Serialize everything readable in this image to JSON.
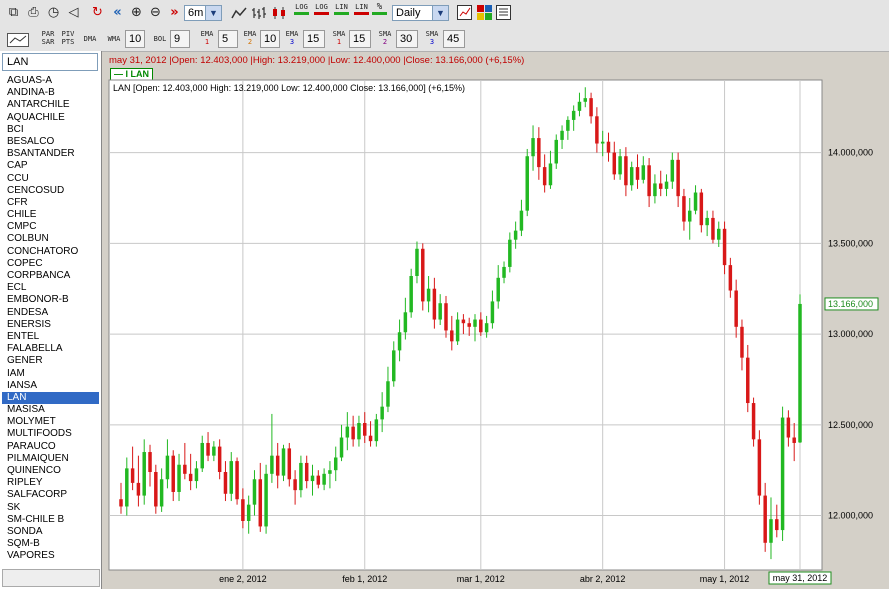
{
  "toolbar1": {
    "period_value": "6m",
    "interval_value": "Daily",
    "scale_buttons": [
      {
        "top": "LOG",
        "name": "log-scale"
      },
      {
        "top": "LOG",
        "name": "log-scale-alt"
      },
      {
        "top": "LIN",
        "name": "linear-scale"
      },
      {
        "top": "LIN",
        "name": "linear-scale-alt"
      },
      {
        "top": "%",
        "name": "percent-scale"
      }
    ]
  },
  "toolbar2": {
    "parsar": {
      "line1": "PAR",
      "line2": "SAR"
    },
    "pivpts": {
      "line1": "PIV",
      "line2": "PTS"
    },
    "dma": "DMA",
    "wma": "WMA",
    "wma_val": "10",
    "bol": "BOL",
    "bol_val": "9",
    "ema1": {
      "line1": "EMA",
      "line2": "1",
      "val": "5"
    },
    "ema2": {
      "line1": "EMA",
      "line2": "2",
      "val": "10"
    },
    "ema3": {
      "line1": "EMA",
      "line2": "3",
      "val": "15"
    },
    "sma1": {
      "line1": "SMA",
      "line2": "1",
      "val": "15"
    },
    "sma2": {
      "line1": "SMA",
      "line2": "2",
      "val": "30"
    },
    "sma3": {
      "line1": "SMA",
      "line2": "3",
      "val": "45"
    }
  },
  "sidebar": {
    "symbol_input": "LAN",
    "symbols": [
      "AGUAS-A",
      "ANDINA-B",
      "ANTARCHILE",
      "AQUACHILE",
      "BCI",
      "BESALCO",
      "BSANTANDER",
      "CAP",
      "CCU",
      "CENCOSUD",
      "CFR",
      "CHILE",
      "CMPC",
      "COLBUN",
      "CONCHATORO",
      "COPEC",
      "CORPBANCA",
      "ECL",
      "EMBONOR-B",
      "ENDESA",
      "ENERSIS",
      "ENTEL",
      "FALABELLA",
      "GENER",
      "IAM",
      "IANSA",
      "LAN",
      "MASISA",
      "MOLYMET",
      "MULTIFOODS",
      "PARAUCO",
      "PILMAIQUEN",
      "QUINENCO",
      "RIPLEY",
      "SALFACORP",
      "SK",
      "SM-CHILE B",
      "SONDA",
      "SQM-B",
      "VAPORES"
    ],
    "selected": "LAN"
  },
  "infobar": "may 31, 2012 |Open: 12.403,000 |High: 13.219,000 |Low: 12.400,000 |Close: 13.166,000 (+6,15%)",
  "legend_tab": "— I LAN",
  "chart_header": "LAN [Open: 12.403,000  High: 13.219,000  Low: 12.400,000  Close: 13.166,000] (+6,15%)",
  "colors": {
    "up": "#22b822",
    "down": "#d81818",
    "grid": "#c8c8c8",
    "last_label": "#1e8c1e",
    "info": "#c00000"
  },
  "chart_data": {
    "type": "candlestick",
    "title": "LAN [Open: 12.403,000  High: 13.219,000  Low: 12.400,000  Close: 13.166,000] (+6,15%)",
    "ylim": [
      11700000,
      14400000
    ],
    "y_ticks": [
      12000000,
      12500000,
      13000000,
      13500000,
      14000000
    ],
    "y_tick_labels": [
      "12.000,000",
      "12.500,000",
      "13.000,000",
      "13.500,000",
      "14.000,000"
    ],
    "x_tick_labels": [
      "ene 2, 2012",
      "feb 1, 2012",
      "mar 1, 2012",
      "abr 2, 2012",
      "may 1, 2012"
    ],
    "x_tick_index": [
      21,
      42,
      62,
      83,
      104
    ],
    "last_date_label": "may 31, 2012",
    "last_price_label": "13.166,000",
    "last_close": 13166000,
    "grid": true,
    "candles": [
      [
        12090000,
        12180000,
        12010000,
        12050000
      ],
      [
        12050000,
        12320000,
        12000000,
        12260000
      ],
      [
        12260000,
        12380000,
        12140000,
        12180000
      ],
      [
        12180000,
        12330000,
        12050000,
        12110000
      ],
      [
        12110000,
        12420000,
        12060000,
        12350000
      ],
      [
        12350000,
        12390000,
        12160000,
        12240000
      ],
      [
        12240000,
        12280000,
        12010000,
        12050000
      ],
      [
        12050000,
        12260000,
        12020000,
        12200000
      ],
      [
        12200000,
        12420000,
        12150000,
        12330000
      ],
      [
        12330000,
        12360000,
        12080000,
        12130000
      ],
      [
        12130000,
        12340000,
        12080000,
        12280000
      ],
      [
        12280000,
        12400000,
        12200000,
        12230000
      ],
      [
        12230000,
        12340000,
        12140000,
        12190000
      ],
      [
        12190000,
        12300000,
        12150000,
        12260000
      ],
      [
        12260000,
        12440000,
        12240000,
        12400000
      ],
      [
        12400000,
        12460000,
        12300000,
        12330000
      ],
      [
        12330000,
        12410000,
        12300000,
        12380000
      ],
      [
        12380000,
        12420000,
        12200000,
        12240000
      ],
      [
        12240000,
        12300000,
        12080000,
        12120000
      ],
      [
        12120000,
        12350000,
        12080000,
        12300000
      ],
      [
        12300000,
        12320000,
        12060000,
        12090000
      ],
      [
        12090000,
        12150000,
        11930000,
        11970000
      ],
      [
        11970000,
        12110000,
        11900000,
        12060000
      ],
      [
        12060000,
        12250000,
        12000000,
        12200000
      ],
      [
        12200000,
        12290000,
        11910000,
        11940000
      ],
      [
        11940000,
        12280000,
        11900000,
        12230000
      ],
      [
        12230000,
        12560000,
        12180000,
        12330000
      ],
      [
        12330000,
        12400000,
        12150000,
        12220000
      ],
      [
        12220000,
        12390000,
        12190000,
        12370000
      ],
      [
        12370000,
        12400000,
        12160000,
        12200000
      ],
      [
        12200000,
        12250000,
        12060000,
        12140000
      ],
      [
        12140000,
        12330000,
        12100000,
        12290000
      ],
      [
        12290000,
        12330000,
        12150000,
        12190000
      ],
      [
        12190000,
        12280000,
        12110000,
        12220000
      ],
      [
        12220000,
        12250000,
        12150000,
        12170000
      ],
      [
        12170000,
        12260000,
        12140000,
        12230000
      ],
      [
        12230000,
        12300000,
        12150000,
        12250000
      ],
      [
        12250000,
        12380000,
        12190000,
        12320000
      ],
      [
        12320000,
        12500000,
        12300000,
        12430000
      ],
      [
        12430000,
        12570000,
        12360000,
        12490000
      ],
      [
        12490000,
        12550000,
        12380000,
        12420000
      ],
      [
        12420000,
        12550000,
        12380000,
        12510000
      ],
      [
        12510000,
        12570000,
        12400000,
        12440000
      ],
      [
        12440000,
        12520000,
        12380000,
        12410000
      ],
      [
        12410000,
        12560000,
        12380000,
        12530000
      ],
      [
        12530000,
        12680000,
        12460000,
        12600000
      ],
      [
        12600000,
        12820000,
        12570000,
        12740000
      ],
      [
        12740000,
        12960000,
        12710000,
        12910000
      ],
      [
        12910000,
        13080000,
        12850000,
        13010000
      ],
      [
        13010000,
        13200000,
        12970000,
        13120000
      ],
      [
        13120000,
        13360000,
        13090000,
        13320000
      ],
      [
        13320000,
        13510000,
        13280000,
        13470000
      ],
      [
        13470000,
        13500000,
        13130000,
        13180000
      ],
      [
        13180000,
        13320000,
        13120000,
        13250000
      ],
      [
        13250000,
        13310000,
        13030000,
        13080000
      ],
      [
        13080000,
        13220000,
        13050000,
        13170000
      ],
      [
        13170000,
        13210000,
        12980000,
        13020000
      ],
      [
        13020000,
        13100000,
        12910000,
        12960000
      ],
      [
        12960000,
        13120000,
        12940000,
        13080000
      ],
      [
        13080000,
        13110000,
        13000000,
        13060000
      ],
      [
        13060000,
        13090000,
        12990000,
        13040000
      ],
      [
        13040000,
        13110000,
        12960000,
        13080000
      ],
      [
        13080000,
        13120000,
        12990000,
        13010000
      ],
      [
        13010000,
        13100000,
        12980000,
        13060000
      ],
      [
        13060000,
        13240000,
        13030000,
        13180000
      ],
      [
        13180000,
        13380000,
        13140000,
        13310000
      ],
      [
        13310000,
        13400000,
        13280000,
        13370000
      ],
      [
        13370000,
        13560000,
        13340000,
        13520000
      ],
      [
        13520000,
        13620000,
        13470000,
        13570000
      ],
      [
        13570000,
        13740000,
        13540000,
        13680000
      ],
      [
        13680000,
        14020000,
        13650000,
        13980000
      ],
      [
        13980000,
        14150000,
        13900000,
        14080000
      ],
      [
        14080000,
        14140000,
        13850000,
        13920000
      ],
      [
        13920000,
        13990000,
        13780000,
        13820000
      ],
      [
        13820000,
        14010000,
        13800000,
        13940000
      ],
      [
        13940000,
        14100000,
        13910000,
        14070000
      ],
      [
        14070000,
        14150000,
        14020000,
        14120000
      ],
      [
        14120000,
        14200000,
        14070000,
        14180000
      ],
      [
        14180000,
        14260000,
        14120000,
        14230000
      ],
      [
        14230000,
        14330000,
        14200000,
        14280000
      ],
      [
        14280000,
        14360000,
        14250000,
        14300000
      ],
      [
        14300000,
        14330000,
        14160000,
        14200000
      ],
      [
        14200000,
        14250000,
        14000000,
        14050000
      ],
      [
        14050000,
        14120000,
        13980000,
        14060000
      ],
      [
        14060000,
        14110000,
        13950000,
        14000000
      ],
      [
        14000000,
        14060000,
        13850000,
        13880000
      ],
      [
        13880000,
        14020000,
        13850000,
        13980000
      ],
      [
        13980000,
        14030000,
        13760000,
        13820000
      ],
      [
        13820000,
        13950000,
        13790000,
        13920000
      ],
      [
        13920000,
        13990000,
        13800000,
        13850000
      ],
      [
        13850000,
        13980000,
        13830000,
        13930000
      ],
      [
        13930000,
        13970000,
        13700000,
        13760000
      ],
      [
        13760000,
        13880000,
        13720000,
        13830000
      ],
      [
        13830000,
        13900000,
        13760000,
        13800000
      ],
      [
        13800000,
        13880000,
        13760000,
        13840000
      ],
      [
        13840000,
        14000000,
        13800000,
        13960000
      ],
      [
        13960000,
        14000000,
        13700000,
        13760000
      ],
      [
        13760000,
        13800000,
        13570000,
        13620000
      ],
      [
        13620000,
        13750000,
        13520000,
        13680000
      ],
      [
        13680000,
        13820000,
        13660000,
        13780000
      ],
      [
        13780000,
        13800000,
        13560000,
        13600000
      ],
      [
        13600000,
        13680000,
        13540000,
        13640000
      ],
      [
        13640000,
        13680000,
        13500000,
        13520000
      ],
      [
        13520000,
        13620000,
        13480000,
        13580000
      ],
      [
        13580000,
        13620000,
        13330000,
        13380000
      ],
      [
        13380000,
        13420000,
        13200000,
        13240000
      ],
      [
        13240000,
        13300000,
        12980000,
        13040000
      ],
      [
        13040000,
        13080000,
        12800000,
        12870000
      ],
      [
        12870000,
        12940000,
        12570000,
        12620000
      ],
      [
        12620000,
        12650000,
        12380000,
        12420000
      ],
      [
        12420000,
        12470000,
        12060000,
        12110000
      ],
      [
        12110000,
        12180000,
        11800000,
        11850000
      ],
      [
        11850000,
        12100000,
        11760000,
        11980000
      ],
      [
        11980000,
        12060000,
        11880000,
        11920000
      ],
      [
        11920000,
        12600000,
        11860000,
        12540000
      ],
      [
        12540000,
        12580000,
        12380000,
        12430000
      ],
      [
        12430000,
        12510000,
        12300000,
        12400000
      ],
      [
        12403000,
        13219000,
        12400000,
        13166000
      ]
    ]
  }
}
